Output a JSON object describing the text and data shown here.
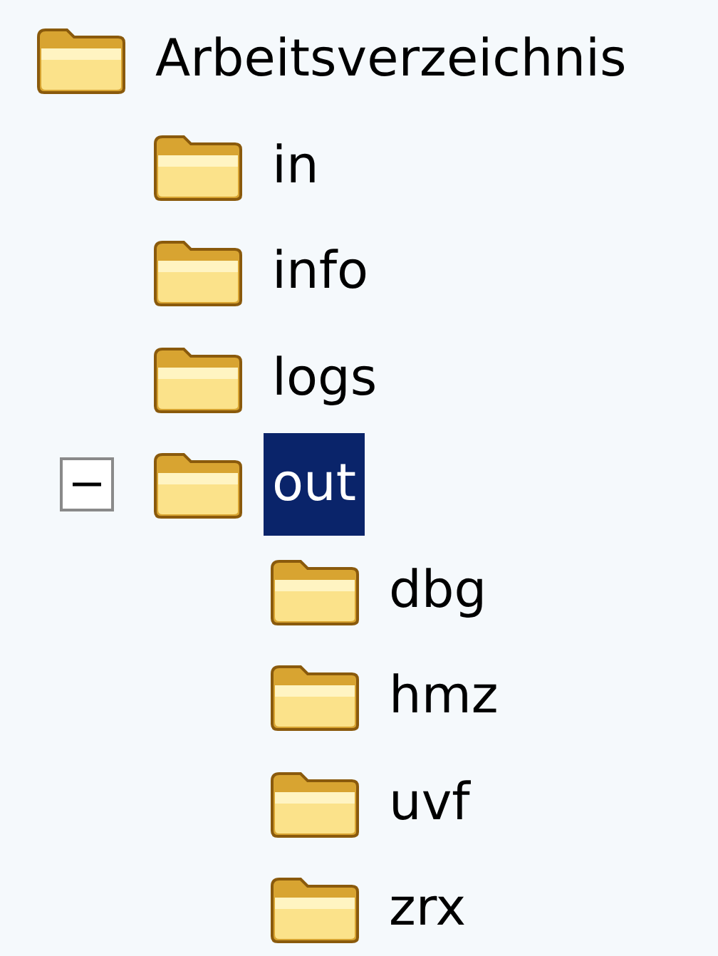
{
  "tree": {
    "label": "Arbeitsverzeichnis",
    "selected": false,
    "children": [
      {
        "label": "in",
        "selected": false
      },
      {
        "label": "info",
        "selected": false
      },
      {
        "label": "logs",
        "selected": false
      },
      {
        "label": "out",
        "selected": true,
        "expanded": true,
        "children": [
          {
            "label": "dbg",
            "selected": false
          },
          {
            "label": "hmz",
            "selected": false
          },
          {
            "label": "uvf",
            "selected": false
          },
          {
            "label": "zrx",
            "selected": false
          }
        ]
      }
    ]
  }
}
